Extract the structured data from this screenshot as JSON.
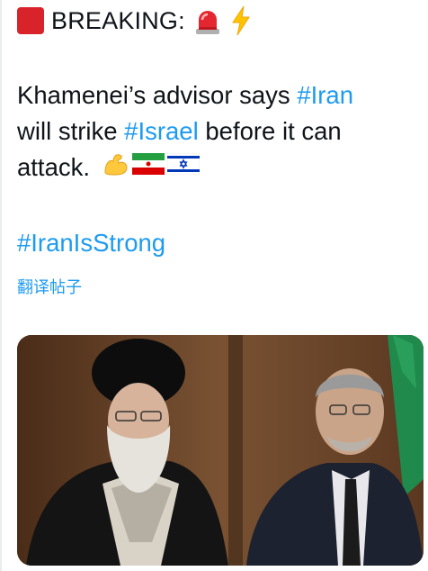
{
  "header": {
    "label": "BREAKING:",
    "icons": [
      "red-square-icon",
      "police-light-icon",
      "lightning-icon"
    ]
  },
  "body": {
    "line1_text": "Khamenei’s advisor says ",
    "line1_tag": "#Iran",
    "line2_text": "will strike ",
    "line2_tag": "#Israel",
    "line2_rest": " before it can",
    "line3_text": "attack.",
    "emojis": [
      "flexed-biceps-icon",
      "iran-flag-icon",
      "israel-flag-icon"
    ]
  },
  "hashtag": "#IranIsStrong",
  "translate_link": "翻译帖子",
  "colors": {
    "link": "#1d9bf0",
    "text": "#0f1419",
    "breaking_square": "#d8232a"
  }
}
